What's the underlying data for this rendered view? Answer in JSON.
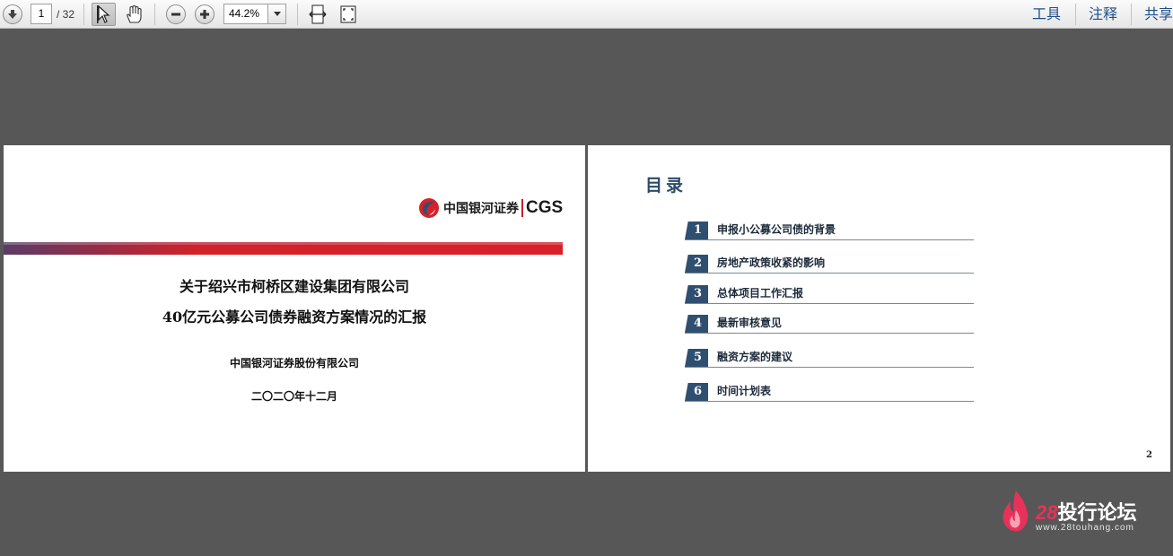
{
  "toolbar": {
    "page_current": "1",
    "page_total": "/ 32",
    "zoom": "44.2%",
    "icons": [
      "next-page-icon",
      "select-cursor-icon",
      "hand-tool-icon",
      "zoom-out-icon",
      "zoom-in-icon",
      "fit-width-icon",
      "fit-page-icon"
    ],
    "right_links": [
      "工具",
      "注释",
      "共享"
    ]
  },
  "page1": {
    "logo_cn": "中国银河证券",
    "logo_en": "CGS",
    "title_line1": "关于绍兴市柯桥区建设集团有限公司",
    "title_line2": "40亿元公募公司债券融资方案情况的汇报",
    "company": "中国银河证券股份有限公司",
    "date": "二〇二〇年十二月"
  },
  "page2": {
    "heading": "目录",
    "items": [
      {
        "num": "1",
        "label": "申报小公募公司债的背景"
      },
      {
        "num": "2",
        "label": "房地产政策收紧的影响"
      },
      {
        "num": "3",
        "label": "总体项目工作汇报"
      },
      {
        "num": "4",
        "label": "最新审核意见"
      },
      {
        "num": "5",
        "label": "融资方案的建议"
      },
      {
        "num": "6",
        "label": "时间计划表"
      }
    ],
    "page_number": "2"
  },
  "watermark": {
    "number": "28",
    "name": "投行论坛",
    "url": "www.28touhang.com"
  },
  "colors": {
    "background": "#575757",
    "toc_accent": "#2f4f70",
    "brand_red": "#d8202a",
    "link_blue": "#1d4f8a"
  }
}
